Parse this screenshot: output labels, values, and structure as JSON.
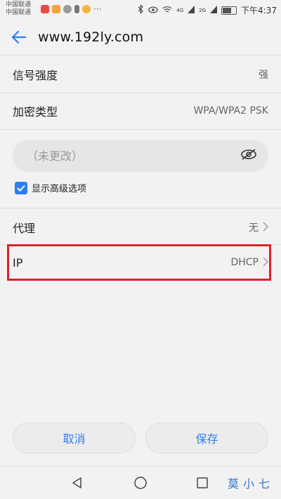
{
  "status_bar": {
    "carrier_1": "中国联通",
    "carrier_2": "中国联通",
    "signal_1": "4G",
    "signal_2": "2G",
    "time": "下午4:37"
  },
  "header": {
    "title": "www.192ly.com"
  },
  "rows": {
    "signal_strength": {
      "label": "信号强度",
      "value": "强"
    },
    "encryption": {
      "label": "加密类型",
      "value": "WPA/WPA2 PSK"
    },
    "proxy": {
      "label": "代理",
      "value": "无"
    },
    "ip": {
      "label": "IP",
      "value": "DHCP"
    }
  },
  "password": {
    "placeholder": "（未更改）"
  },
  "advanced": {
    "label": "显示高级选项",
    "checked": true
  },
  "buttons": {
    "cancel": "取消",
    "save": "保存"
  },
  "watermark": "莫小七",
  "colors": {
    "accent": "#2d7ef7",
    "highlight": "#e0202a",
    "background": "#f2f2f2"
  }
}
